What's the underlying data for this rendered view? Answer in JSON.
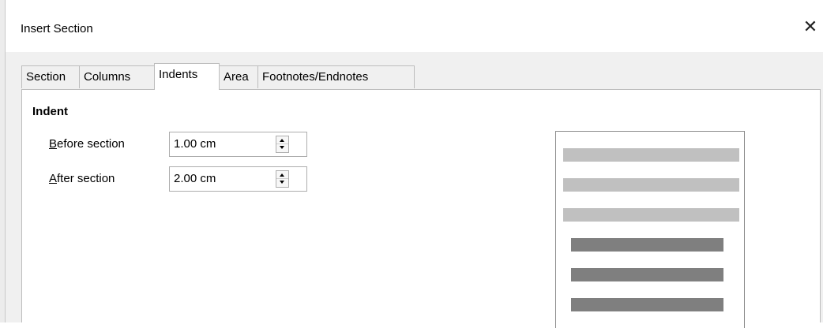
{
  "dialog": {
    "title": "Insert Section",
    "close_glyph": "✕"
  },
  "tabs": [
    {
      "label": "Section",
      "active": false
    },
    {
      "label": "Columns",
      "active": false
    },
    {
      "label": "Indents",
      "active": true
    },
    {
      "label": "Area",
      "active": false
    },
    {
      "label": "Footnotes/Endnotes",
      "active": false
    }
  ],
  "indent": {
    "heading": "Indent",
    "before": {
      "mnemonic": "B",
      "rest": "efore section",
      "value": "1.00 cm"
    },
    "after": {
      "mnemonic": "A",
      "rest": "fter section",
      "value": "2.00 cm"
    }
  },
  "icons": {
    "close": "close-icon",
    "spin_up": "chevron-up-icon",
    "spin_down": "chevron-down-icon"
  },
  "colors": {
    "preview_surrounding_text": "#c0c0c0",
    "preview_section_text": "#7f7f7f"
  }
}
